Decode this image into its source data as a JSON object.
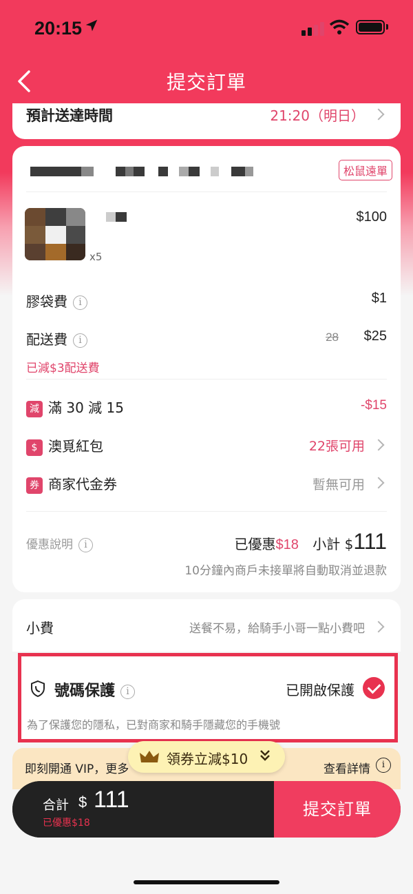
{
  "status_bar": {
    "time": "20:15"
  },
  "header": {
    "title": "提交訂單"
  },
  "eta": {
    "label": "預計送達時間",
    "value": "21:20（明日）"
  },
  "order": {
    "store_tag": "松鼠遠單",
    "item": {
      "price": "$100",
      "qty": "x5"
    },
    "fees": [
      {
        "label": "膠袋費",
        "value": "$1"
      },
      {
        "label": "配送費",
        "value": "$25",
        "original": "28"
      }
    ],
    "delivery_saved_note": "已減$3配送費",
    "promos": [
      {
        "badge": "減",
        "label": "滿 30 減 15",
        "value": "-$15"
      },
      {
        "badge": "$",
        "label": "澳覓紅包",
        "value": "22張可用"
      },
      {
        "badge": "券",
        "label": "商家代金券",
        "value": "暫無可用"
      }
    ],
    "summary": {
      "label": "優惠說明",
      "saved_label": "已優惠",
      "saved_value": "$18",
      "subtotal_label": "小計 $",
      "subtotal_value": "111",
      "cancel_note": "10分鐘內商戶未接單將自動取消並退款"
    }
  },
  "tip": {
    "label": "小費",
    "hint": "送餐不易，給騎手小哥一點小費吧"
  },
  "protection": {
    "title": "號碼保護",
    "status": "已開啟保護",
    "description": "為了保護您的隱私，已對商家和騎手隱藏您的手機號"
  },
  "vip": {
    "text": "即刻開通 VIP，更多",
    "detail": "查看詳情"
  },
  "coupon_pill": {
    "text": "領券立減$10"
  },
  "bottom": {
    "total_label": "合計",
    "currency": "$",
    "total_value": "111",
    "saved_note": "已優惠$18",
    "submit_label": "提交訂單"
  },
  "colors": {
    "brand": "#f23a5c",
    "accent_text": "#e0456b",
    "highlight_border": "#e8324f",
    "vip_bg": "#fbe6c2"
  },
  "icons": [
    "back-arrow-icon",
    "location-arrow-icon",
    "signal-icon",
    "wifi-icon",
    "battery-icon",
    "info-icon",
    "chevron-right-icon",
    "shield-phone-icon",
    "check-icon",
    "crown-icon",
    "double-chevron-down-icon"
  ]
}
